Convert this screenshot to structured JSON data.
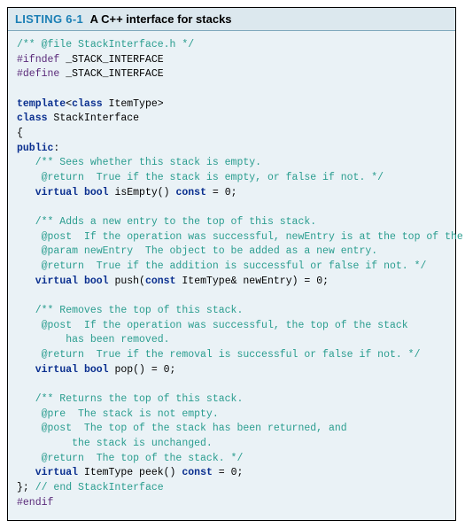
{
  "header": {
    "listing_label": "LISTING 6-1",
    "listing_title": "A C++ interface for stacks"
  },
  "code": {
    "c_file": "/** @file StackInterface.h */",
    "pp_ifndef": "#ifndef",
    "pp_define": "#define",
    "pp_guard": " _STACK_INTERFACE",
    "kw_template": "template",
    "tmpl_open": "<",
    "kw_class": "class",
    "tmpl_rest": " ItemType>",
    "class_decl_1": " StackInterface",
    "brace_open": "{",
    "kw_public": "public",
    "public_colon": ":",
    "c_isEmpty1": "   /** Sees whether this stack is empty.",
    "c_isEmpty2": "    @return  True if the stack is empty, or false if not. */",
    "kw_virtual": "virtual",
    "kw_bool": "bool",
    "isEmpty_sig": " isEmpty() ",
    "kw_const": "const",
    "eq0": " = 0;",
    "c_push1": "   /** Adds a new entry to the top of this stack.",
    "c_push2": "    @post  If the operation was successful, newEntry is at the top of the stack.",
    "c_push3": "    @param newEntry  The object to be added as a new entry.",
    "c_push4": "    @return  True if the addition is successful or false if not. */",
    "push_sig1": " push(",
    "push_sig2": " ItemType& newEntry) = 0;",
    "c_pop1": "   /** Removes the top of this stack.",
    "c_pop2": "    @post  If the operation was successful, the top of the stack",
    "c_pop3": "        has been removed.",
    "c_pop4": "    @return  True if the removal is successful or false if not. */",
    "pop_sig": " pop() = 0;",
    "c_peek1": "   /** Returns the top of this stack.",
    "c_peek2": "    @pre  The stack is not empty.",
    "c_peek3": "    @post  The top of the stack has been returned, and",
    "c_peek4": "         the stack is unchanged.",
    "c_peek5": "    @return  The top of the stack. */",
    "peek_sig1": " ItemType peek() ",
    "brace_close": "}; ",
    "c_end": "// end StackInterface",
    "pp_endif": "#endif"
  }
}
